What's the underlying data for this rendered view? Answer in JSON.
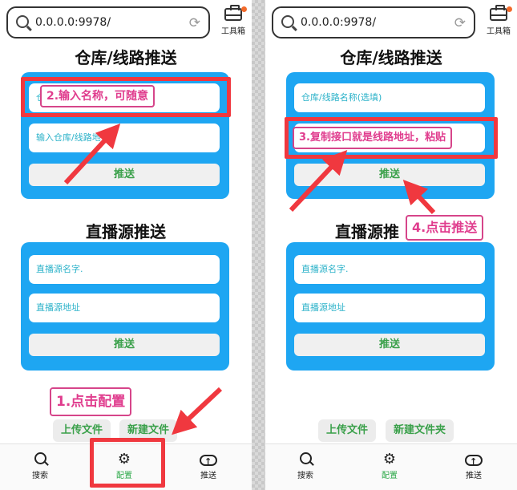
{
  "url": "0.0.0.0:9978/",
  "refresh_icon": "refresh-icon",
  "toolbox_label": "工具箱",
  "warehouse_title": "仓库/线路推送",
  "live_title": "直播源推送",
  "left_panel": {
    "warehouse_name_value": "仓",
    "warehouse_url_placeholder": "输入仓库/线路地",
    "push_label": "推送",
    "live_name_placeholder": "直播源名字.",
    "live_url_placeholder": "直播源地址",
    "live_push_label": "推送",
    "upload_label": "上传文件",
    "new_folder_label": "新建文件"
  },
  "right_panel": {
    "warehouse_name_placeholder": "仓库/线路名称(选填)",
    "push_label": "推送",
    "live_title": "直播源推",
    "live_name_placeholder": "直播源名字.",
    "live_url_placeholder": "直播源地址",
    "live_push_label": "推送",
    "upload_label": "上传文件",
    "new_folder_label": "新建文件夹"
  },
  "nav": {
    "search": "搜索",
    "config": "配置",
    "push": "推送"
  },
  "annotations": {
    "step1": "1.点击配置",
    "step2": "2.输入名称，可随意",
    "step3": "3.复制接口就是线路地址，粘贴",
    "step4": "4.点击推送"
  },
  "colors": {
    "card_blue": "#1ea6f2",
    "accent_green": "#3aa04a",
    "annotation_red": "#f0383f",
    "annotation_pink": "#e03d8e"
  }
}
